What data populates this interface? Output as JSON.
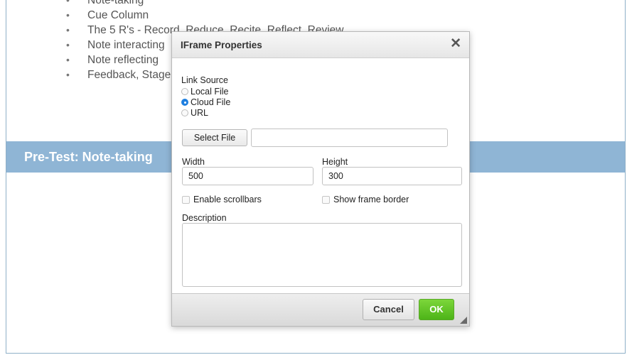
{
  "page": {
    "bullets": [
      "Cue Column",
      "The 5 R's - Record, Reduce, Recite, Reflect, Review",
      "Note interacting",
      "Note reflecting",
      "Feedback, Stage"
    ],
    "bullet_glyph": "•",
    "section_title": "Pre-Test: Note-taking"
  },
  "dialog": {
    "title": "IFrame Properties",
    "close_glyph": "✕",
    "link_source_label": "Link Source",
    "link_source_options": [
      "Local File",
      "Cloud File",
      "URL"
    ],
    "link_source_selected": "Cloud File",
    "select_file_label": "Select File",
    "file_value": "",
    "width_label": "Width",
    "width_value": "500",
    "height_label": "Height",
    "height_value": "300",
    "enable_scrollbars_label": "Enable scrollbars",
    "show_border_label": "Show frame border",
    "description_label": "Description",
    "description_value": "",
    "cancel_label": "Cancel",
    "ok_label": "OK"
  },
  "colors": {
    "banner": "#8fb5d5",
    "ok_button": "#4db418",
    "radio_selected": "#1f7fe0"
  }
}
